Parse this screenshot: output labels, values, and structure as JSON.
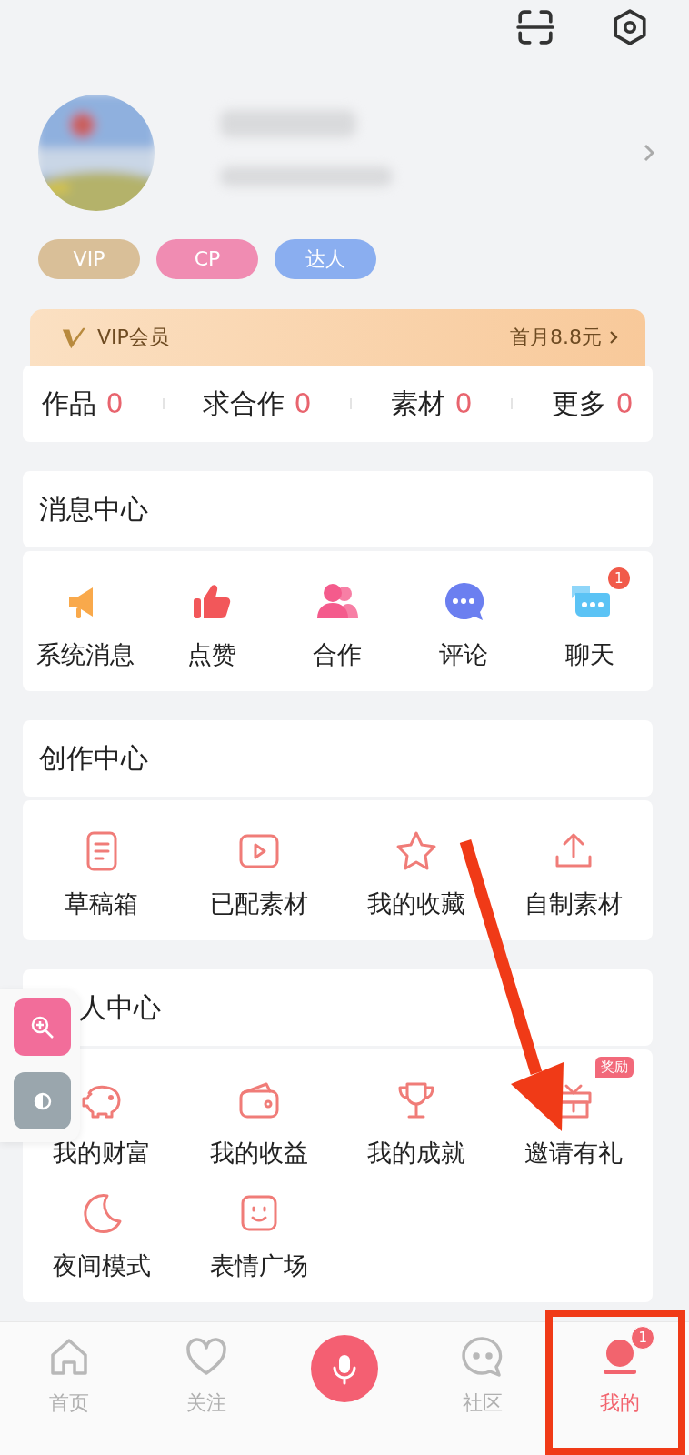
{
  "profile": {
    "badges": [
      {
        "label": "VIP",
        "kind": "vip"
      },
      {
        "label": "CP",
        "kind": "cp"
      },
      {
        "label": "达人",
        "kind": "expert"
      }
    ]
  },
  "vip_banner": {
    "title": "VIP会员",
    "offer": "首月8.8元"
  },
  "stats": [
    {
      "label": "作品",
      "count": "0"
    },
    {
      "label": "求合作",
      "count": "0"
    },
    {
      "label": "素材",
      "count": "0"
    },
    {
      "label": "更多",
      "count": "0"
    }
  ],
  "sections": [
    {
      "title": "消息中心",
      "items": [
        {
          "label": "系统消息",
          "kind": "megaphone"
        },
        {
          "label": "点赞",
          "kind": "thumb"
        },
        {
          "label": "合作",
          "kind": "people"
        },
        {
          "label": "评论",
          "kind": "comment"
        },
        {
          "label": "聊天",
          "kind": "chat",
          "badge": "1"
        }
      ]
    },
    {
      "title": "创作中心",
      "items": [
        {
          "label": "草稿箱",
          "kind": "document"
        },
        {
          "label": "已配素材",
          "kind": "play"
        },
        {
          "label": "我的收藏",
          "kind": "star"
        },
        {
          "label": "自制素材",
          "kind": "upload"
        }
      ]
    },
    {
      "title": "人中心",
      "items": [
        {
          "label": "我的财富",
          "kind": "piggy"
        },
        {
          "label": "我的收益",
          "kind": "wallet"
        },
        {
          "label": "我的成就",
          "kind": "trophy"
        },
        {
          "label": "邀请有礼",
          "kind": "gift",
          "tag": "奖励"
        },
        {
          "label": "夜间模式",
          "kind": "moon"
        },
        {
          "label": "表情广场",
          "kind": "smile"
        }
      ]
    }
  ],
  "nav": [
    {
      "label": "首页",
      "kind": "home",
      "selected": false
    },
    {
      "label": "关注",
      "kind": "heart",
      "selected": false
    },
    {
      "kind": "mic",
      "selected": false
    },
    {
      "label": "社区",
      "kind": "bubble",
      "selected": false
    },
    {
      "label": "我的",
      "kind": "me",
      "selected": true,
      "badge": "1"
    }
  ]
}
